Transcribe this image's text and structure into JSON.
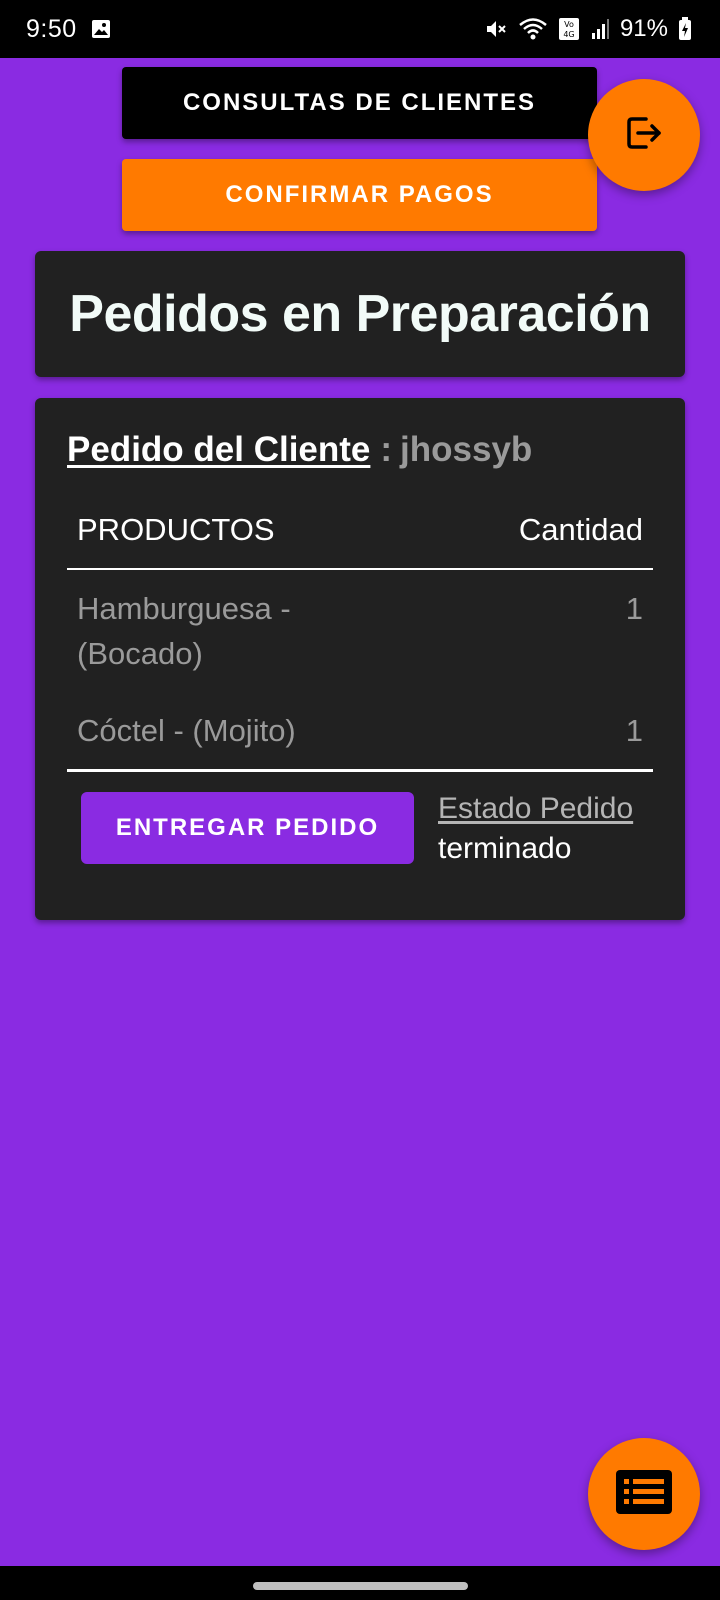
{
  "status_bar": {
    "time": "9:50",
    "battery": "91%",
    "icons": [
      "image-icon",
      "mute-icon",
      "wifi-icon",
      "volte-icon",
      "signal-icon",
      "battery-charging-icon"
    ]
  },
  "buttons": {
    "consultas": "CONSULTAS DE CLIENTES",
    "confirmar": "CONFIRMAR PAGOS"
  },
  "fabs": {
    "logout_icon": "logout-icon",
    "list_icon": "list-icon"
  },
  "page_title": "Pedidos en Preparación",
  "order": {
    "header_label": "Pedido del Cliente",
    "separator": ":",
    "client": "jhossyb",
    "columns": {
      "product": "PRODUCTOS",
      "quantity": "Cantidad"
    },
    "items": [
      {
        "product": "Hamburguesa - (Bocado)",
        "quantity": "1"
      },
      {
        "product": "Cóctel - (Mojito)",
        "quantity": "1"
      }
    ],
    "deliver_button": "ENTREGAR PEDIDO",
    "status_label": "Estado Pedido",
    "status_value": "terminado"
  },
  "colors": {
    "background": "#8a2be2",
    "accent": "#ff7a00",
    "card": "#212121"
  }
}
